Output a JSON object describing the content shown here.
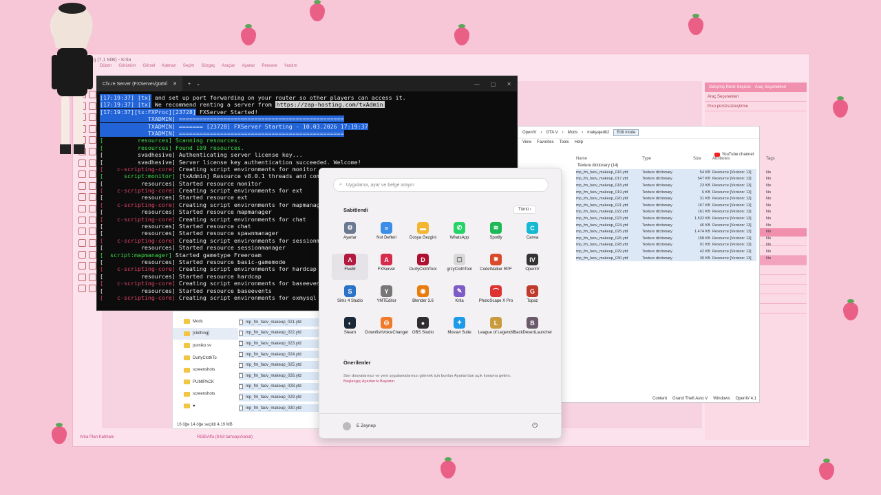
{
  "krita": {
    "title": "25.png (7,1 MiB) - Krita",
    "menu": [
      "Dosya",
      "Düzen",
      "Görünüm",
      "Görsel",
      "Katman",
      "Seçim",
      "Süzgeç",
      "Araçlar",
      "Ayarlar",
      "Pencere",
      "Yardım"
    ],
    "panel_tabs": [
      "Gelişmiş Renk Seçicisi",
      "Araç Seçenekleri"
    ],
    "tool_options": [
      "Araç Seçenekleri",
      "Pıxo pürüzsüzleştirme"
    ],
    "status_left": "Arka Plan Katmanı",
    "status_mid": "RGB/Alfa (8-bit tamsayı/kanal)",
    "status_right": "0.00°"
  },
  "terminal": {
    "tab_title": "Cfx.re Server (FXServer/gta5/i",
    "lines": [
      {
        "tag": "[17:19:37] [tx]",
        "text": " and set up port forwarding on your router so other players can access it.",
        "c": ""
      },
      {
        "tag": "[17:19:37] [tx]",
        "text": " We recommend renting a server from ",
        "url": "https://zap-hosting.com/txAdmin",
        "c": ""
      },
      {
        "tag": "[17:19:37][tx:FXProc][23728]",
        "text": " FXServer Started!",
        "c": ""
      },
      {
        "tag": "              TXADMIN]",
        "text": " ================================================",
        "c": "hl"
      },
      {
        "tag": "              TXADMIN]",
        "text": " ======= [23728] FXServer Starting - 10.03.2026 17:19:37",
        "c": "hl"
      },
      {
        "tag": "              TXADMIN]",
        "text": " ================================================",
        "c": "hl"
      },
      {
        "tag": "[          resources]",
        "text": " Scanning resources.",
        "c": "gr"
      },
      {
        "tag": "[          resources]",
        "text": " Found 109 resources.",
        "c": "gr"
      },
      {
        "tag": "[          svadhesive]",
        "text": " Authenticating server license key...",
        "c": ""
      },
      {
        "tag": "[          svadhesive]",
        "text": " Server license key authentication succeeded. Welcome!",
        "c": ""
      },
      {
        "tag": "[    c-scripting-core]",
        "text": " Creating script environments for monitor",
        "c": "rdtag"
      },
      {
        "tag": "[      script:monitor]",
        "text": " [txAdmin] Resource v8.0.1 threads and comm",
        "c": "grtag"
      },
      {
        "tag": "[           resources]",
        "text": " Started resource monitor",
        "c": ""
      },
      {
        "tag": "[    c-scripting-core]",
        "text": " Creating script environments for ext",
        "c": "rdtag"
      },
      {
        "tag": "[           resources]",
        "text": " Started resource ext",
        "c": ""
      },
      {
        "tag": "[    c-scripting-core]",
        "text": " Creating script environments for mapmanage",
        "c": "rdtag"
      },
      {
        "tag": "[           resources]",
        "text": " Started resource mapmanager",
        "c": ""
      },
      {
        "tag": "[    c-scripting-core]",
        "text": " Creating script environments for chat",
        "c": "rdtag"
      },
      {
        "tag": "[           resources]",
        "text": " Started resource chat",
        "c": ""
      },
      {
        "tag": "[           resources]",
        "text": " Started resource spawnmanager",
        "c": ""
      },
      {
        "tag": "[    c-scripting-core]",
        "text": " Creating script environments for sessionma",
        "c": "rdtag"
      },
      {
        "tag": "[           resources]",
        "text": " Started resource sessionmanager",
        "c": ""
      },
      {
        "tag": "[  script:mapmanager]",
        "text": " Started gametype Freeroam",
        "c": "grtag"
      },
      {
        "tag": "[           resources]",
        "text": " Started resource basic-gamemode",
        "c": ""
      },
      {
        "tag": "[    c-scripting-core]",
        "text": " Creating script environments for hardcap",
        "c": "rdtag"
      },
      {
        "tag": "[           resources]",
        "text": " Started resource hardcap",
        "c": ""
      },
      {
        "tag": "[    c-scripting-core]",
        "text": " Creating script environments for baseevent",
        "c": "rdtag"
      },
      {
        "tag": "[           resources]",
        "text": " Started resource baseevents",
        "c": ""
      },
      {
        "tag": "[    c-scripting-core]",
        "text": " Creating script environments for oxmysql",
        "c": "rdtag"
      }
    ]
  },
  "explorer_left": {
    "nav": [
      "Mods",
      "[clothing]",
      "pumiko sv",
      "DurtyClothTo",
      "screenshots",
      "PUMIPACK",
      "screenshots",
      "♥"
    ],
    "files": [
      "mp_fm_faov_makeup_021.ytd",
      "mp_fm_faov_makeup_022.ytd",
      "mp_fm_faov_makeup_023.ytd",
      "mp_fm_faov_makeup_024.ytd",
      "mp_fm_faov_makeup_025.ytd",
      "mp_fm_faov_makeup_026.ytd",
      "mp_fm_faov_makeup_028.ytd",
      "mp_fm_faov_makeup_029.ytd",
      "mp_fm_faov_makeup_030.ytd"
    ],
    "status": "16 öğe     14 öğe seçildi  4,19 MB"
  },
  "explorer_right": {
    "crumbs": [
      "OpenIV",
      "GTA V",
      "Mods",
      "makyajedit2"
    ],
    "edit_mode": "Edit mode",
    "ribbon": [
      "View",
      "Favorites",
      "Tools",
      "Help"
    ],
    "youtube": "YouTube channel",
    "headers": [
      "Name",
      "Type",
      "Size",
      "Attributes",
      "Tags"
    ],
    "group": "Texture dictionary (14)",
    "rows": [
      {
        "name": "mp_fm_faov_makeup_016.ytd",
        "type": "Texture dictionary",
        "size": "54 KB",
        "attr": "Resource [Version: 13]",
        "tag": "No"
      },
      {
        "name": "mp_fm_faov_makeup_017.ytd",
        "type": "Texture dictionary",
        "size": "547 KB",
        "attr": "Resource [Version: 13]",
        "tag": "No"
      },
      {
        "name": "mp_fm_faov_makeup_018.ytd",
        "type": "Texture dictionary",
        "size": "23 KB",
        "attr": "Resource [Version: 13]",
        "tag": "No"
      },
      {
        "name": "mp_fm_faov_makeup_019.ytd",
        "type": "Texture dictionary",
        "size": "6 KB",
        "attr": "Resource [Version: 13]",
        "tag": "No"
      },
      {
        "name": "mp_fm_faov_makeup_020.ytd",
        "type": "Texture dictionary",
        "size": "31 KB",
        "attr": "Resource [Version: 13]",
        "tag": "No"
      },
      {
        "name": "mp_fm_faov_makeup_021.ytd",
        "type": "Texture dictionary",
        "size": "167 KB",
        "attr": "Resource [Version: 13]",
        "tag": "No"
      },
      {
        "name": "mp_fm_faov_makeup_022.ytd",
        "type": "Texture dictionary",
        "size": "161 KB",
        "attr": "Resource [Version: 13]",
        "tag": "No"
      },
      {
        "name": "mp_fm_faov_makeup_023.ytd",
        "type": "Texture dictionary",
        "size": "1.532 KB",
        "attr": "Resource [Version: 13]",
        "tag": "No"
      },
      {
        "name": "mp_fm_faov_makeup_024.ytd",
        "type": "Texture dictionary",
        "size": "46 KB",
        "attr": "Resource [Version: 13]",
        "tag": "No"
      },
      {
        "name": "mp_fm_faov_makeup_025.ytd",
        "type": "Texture dictionary",
        "size": "1.474 KB",
        "attr": "Resource [Version: 13]",
        "tag": "No"
      },
      {
        "name": "mp_fm_faov_makeup_026.ytd",
        "type": "Texture dictionary",
        "size": "158 KB",
        "attr": "Resource [Version: 13]",
        "tag": "No"
      },
      {
        "name": "mp_fm_faov_makeup_028.ytd",
        "type": "Texture dictionary",
        "size": "91 KB",
        "attr": "Resource [Version: 13]",
        "tag": "No"
      },
      {
        "name": "mp_fm_faov_makeup_029.ytd",
        "type": "Texture dictionary",
        "size": "42 KB",
        "attr": "Resource [Version: 13]",
        "tag": "No"
      },
      {
        "name": "mp_fm_faov_makeup_030.ytd",
        "type": "Texture dictionary",
        "size": "30 KB",
        "attr": "Resource [Version: 13]",
        "tag": "No"
      }
    ],
    "status": [
      "Content",
      "Grand Theft Auto V",
      "Windows",
      "OpenIV 4.1"
    ]
  },
  "start_menu": {
    "search_placeholder": "Uygulama, ayar ve belge arayın",
    "pinned_title": "Sabitlendi",
    "all_button": "Tümü  ›",
    "apps": [
      {
        "label": "Ayarlar",
        "icon": "gear-icon",
        "color": "#6b7a90",
        "glyph": "⚙"
      },
      {
        "label": "Not Defteri",
        "icon": "notepad-icon",
        "color": "#3a8ee6",
        "glyph": "≡"
      },
      {
        "label": "Dosya Gezgini",
        "icon": "folder-icon",
        "color": "#f2b632",
        "glyph": "▬"
      },
      {
        "label": "WhatsApp",
        "icon": "whatsapp-icon",
        "color": "#25d366",
        "glyph": "✆"
      },
      {
        "label": "Spotify",
        "icon": "spotify-icon",
        "color": "#1db954",
        "glyph": "≋"
      },
      {
        "label": "Canva",
        "icon": "canva-icon",
        "color": "#15b9d1",
        "glyph": "C"
      },
      {
        "label": "FiveM",
        "icon": "fivem-icon",
        "color": "#b3183d",
        "glyph": "Λ"
      },
      {
        "label": "FXServer",
        "icon": "fxserver-icon",
        "color": "#d62b4b",
        "glyph": "A"
      },
      {
        "label": "DurtyClothTool",
        "icon": "durtycloth-icon",
        "color": "#b01030",
        "glyph": "D"
      },
      {
        "label": "grzyClothTool",
        "icon": "grzycloth-icon",
        "color": "#d8d8d8",
        "glyph": "▢"
      },
      {
        "label": "CodeWalker RPF",
        "icon": "codewalker-icon",
        "color": "#d84a2a",
        "glyph": "✸"
      },
      {
        "label": "OpenIV",
        "icon": "openiv-icon",
        "color": "#333333",
        "glyph": "IV"
      },
      {
        "label": "Sims 4 Studio",
        "icon": "sims-studio-icon",
        "color": "#2a73c8",
        "glyph": "S"
      },
      {
        "label": "YMTEditor",
        "icon": "ymteditor-icon",
        "color": "#777777",
        "glyph": "Y"
      },
      {
        "label": "Blender 3.6",
        "icon": "blender-icon",
        "color": "#e87d0d",
        "glyph": "◉"
      },
      {
        "label": "Krita",
        "icon": "krita-icon",
        "color": "#7d5cc7",
        "glyph": "✎"
      },
      {
        "label": "PhotoScape X Pro",
        "icon": "photoscape-icon",
        "color": "#d33",
        "glyph": "⌒"
      },
      {
        "label": "Topaz",
        "icon": "topaz-icon",
        "color": "#c0392b",
        "glyph": "G"
      },
      {
        "label": "Steam",
        "icon": "steam-icon",
        "color": "#1b2838",
        "glyph": "◐"
      },
      {
        "label": "ClownfishVoiceChanger",
        "icon": "clownfish-icon",
        "color": "#f07a2a",
        "glyph": "◎"
      },
      {
        "label": "OBS Studio",
        "icon": "obs-icon",
        "color": "#302e31",
        "glyph": "●"
      },
      {
        "label": "Movavi Suite",
        "icon": "movavi-icon",
        "color": "#1e9be8",
        "glyph": "✦"
      },
      {
        "label": "League of Legends",
        "icon": "league-icon",
        "color": "#c89b3c",
        "glyph": "L"
      },
      {
        "label": "BlackDesertLauncher",
        "icon": "blackdesert-icon",
        "color": "#6a5a6a",
        "glyph": "B"
      }
    ],
    "recommended_title": "Önerilenler",
    "recommended_text": "Son dosyalarınızı ve yeni uygulamalarınızı görmek için bunları Ayarlar'dan açık konuma getirin.",
    "recommended_link": "Başlangıç Ayarlarını Başlatın.",
    "user": "E Zeynep",
    "power": "⏻"
  }
}
